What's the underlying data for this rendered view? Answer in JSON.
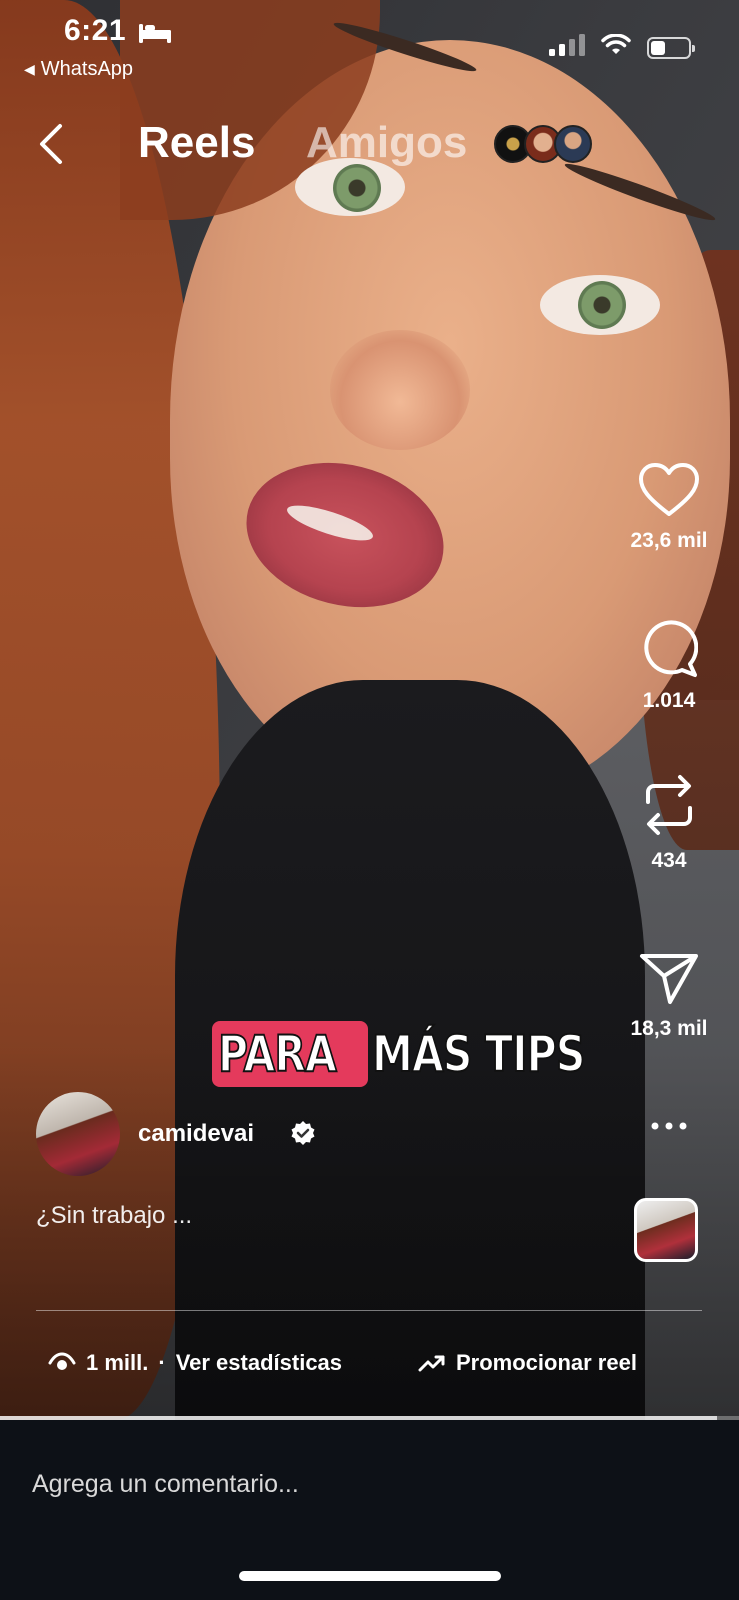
{
  "status_bar": {
    "time": "6:21",
    "back_app": "WhatsApp",
    "icons": [
      "bed-icon",
      "signal-icon",
      "wifi-icon",
      "battery-icon"
    ]
  },
  "header": {
    "tabs": [
      {
        "label": "Reels",
        "active": true
      },
      {
        "label": "Amigos",
        "active": false
      }
    ]
  },
  "actions": {
    "likes": "23,6 mil",
    "comments": "1.014",
    "reposts": "434",
    "shares": "18,3 mil"
  },
  "overlay_text": {
    "highlight": "PARA",
    "rest": "MÁS TIPS",
    "highlight_color": "#e43a5c"
  },
  "post": {
    "username": "camidevai",
    "verified": true,
    "caption": "¿Sin trabajo ..."
  },
  "footer": {
    "views": "1 mill.",
    "separator": "·",
    "stats_label": "Ver estadísticas",
    "promote_label": "Promocionar reel"
  },
  "progress": 0.97,
  "comment": {
    "placeholder": "Agrega un comentario..."
  }
}
